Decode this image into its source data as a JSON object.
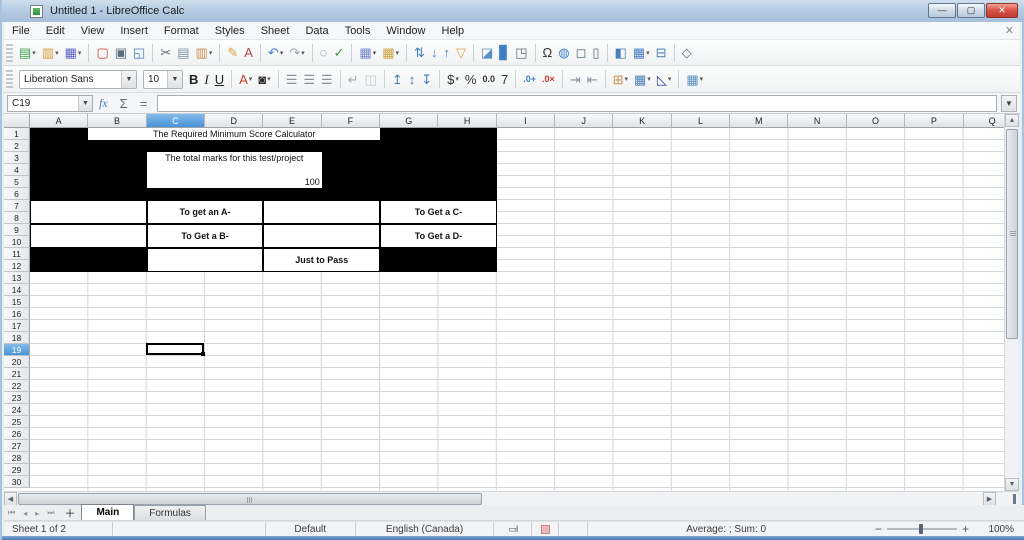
{
  "window": {
    "title": "Untitled 1 - LibreOffice Calc",
    "controls": {
      "minimize": "—",
      "maximize": "▢",
      "close": "✕"
    }
  },
  "menu": {
    "items": [
      "File",
      "Edit",
      "View",
      "Insert",
      "Format",
      "Styles",
      "Sheet",
      "Data",
      "Tools",
      "Window",
      "Help"
    ],
    "close_document": "✕"
  },
  "toolbar_main": {
    "items": [
      {
        "name": "new",
        "glyph": "▤",
        "color": "#3f9e4d",
        "dropdown": true
      },
      {
        "name": "open",
        "glyph": "▥",
        "color": "#dc9a3a",
        "dropdown": true
      },
      {
        "name": "save",
        "glyph": "▦",
        "color": "#5b63c6",
        "dropdown": true
      },
      {
        "name": "sep"
      },
      {
        "name": "export-pdf",
        "glyph": "▢",
        "color": "#cf4436"
      },
      {
        "name": "print",
        "glyph": "▣",
        "color": "#5a6b7c"
      },
      {
        "name": "print-preview",
        "glyph": "◱",
        "color": "#4a7ebb"
      },
      {
        "name": "sep"
      },
      {
        "name": "cut",
        "glyph": "✂",
        "color": "#5a6b7c"
      },
      {
        "name": "copy",
        "glyph": "▤",
        "color": "#7d93a8"
      },
      {
        "name": "paste",
        "glyph": "▥",
        "color": "#c98f4e",
        "dropdown": true
      },
      {
        "name": "sep"
      },
      {
        "name": "clone-formatting",
        "glyph": "✎",
        "color": "#d9a23c"
      },
      {
        "name": "clear-formatting",
        "glyph": "A",
        "color": "#b04a52"
      },
      {
        "name": "sep"
      },
      {
        "name": "undo",
        "glyph": "↶",
        "color": "#3f7fc4",
        "dropdown": true
      },
      {
        "name": "redo",
        "glyph": "↷",
        "color": "#9aa6b2",
        "dropdown": true
      },
      {
        "name": "sep"
      },
      {
        "name": "find-and-replace",
        "glyph": "◌",
        "color": "#4a7ebb"
      },
      {
        "name": "spelling",
        "glyph": "✓",
        "color": "#3f9e4d"
      },
      {
        "name": "sep"
      },
      {
        "name": "insert-row",
        "glyph": "▦",
        "color": "#6f87c9",
        "dropdown": true
      },
      {
        "name": "insert-column",
        "glyph": "▦",
        "color": "#c9a23c",
        "dropdown": true
      },
      {
        "name": "sep"
      },
      {
        "name": "sort",
        "glyph": "⇅",
        "color": "#3f7fc4"
      },
      {
        "name": "sort-ascending",
        "glyph": "↓",
        "color": "#3f7fc4"
      },
      {
        "name": "sort-descending",
        "glyph": "↑",
        "color": "#3f7fc4"
      },
      {
        "name": "autofilter",
        "glyph": "▽",
        "color": "#d9a23c"
      },
      {
        "name": "sep"
      },
      {
        "name": "insert-image",
        "glyph": "◪",
        "color": "#5a8fc4"
      },
      {
        "name": "insert-chart",
        "glyph": "▊",
        "color": "#3f7fc4"
      },
      {
        "name": "insert-pivot-table",
        "glyph": "◳",
        "color": "#5a6b7c"
      },
      {
        "name": "sep"
      },
      {
        "name": "special-character",
        "glyph": "Ω",
        "color": "#333333"
      },
      {
        "name": "insert-hyperlink",
        "glyph": "◍",
        "color": "#3f7fc4"
      },
      {
        "name": "insert-comment",
        "glyph": "◻",
        "color": "#5a6b7c"
      },
      {
        "name": "headers-and-footers",
        "glyph": "▯",
        "color": "#5a6b7c"
      },
      {
        "name": "sep"
      },
      {
        "name": "insert-page-break",
        "glyph": "◧",
        "color": "#4a7ebb"
      },
      {
        "name": "freeze-rows-and-columns",
        "glyph": "▦",
        "color": "#4a7ebb",
        "dropdown": true
      },
      {
        "name": "split-window",
        "glyph": "⊟",
        "color": "#4a7ebb"
      },
      {
        "name": "sep"
      },
      {
        "name": "show-draw-functions",
        "glyph": "◇",
        "color": "#5a6b7c"
      }
    ]
  },
  "toolbar_format": {
    "font_name": "Liberation Sans",
    "font_size": "10",
    "items": [
      {
        "name": "bold",
        "glyph": "B",
        "color": "#222",
        "cls": "bold-b"
      },
      {
        "name": "italic",
        "glyph": "I",
        "color": "#222",
        "cls": "ital-i"
      },
      {
        "name": "underline",
        "glyph": "U",
        "color": "#222",
        "cls": "und-u"
      },
      {
        "name": "sep"
      },
      {
        "name": "font-color",
        "glyph": "A",
        "color": "#c0392b",
        "dropdown": true
      },
      {
        "name": "highlighting-color",
        "glyph": "◙",
        "color": "#2b2b2b",
        "dropdown": true
      },
      {
        "name": "sep"
      },
      {
        "name": "align-left",
        "glyph": "☰",
        "color": "#8a949e"
      },
      {
        "name": "align-center",
        "glyph": "☰",
        "color": "#8a949e"
      },
      {
        "name": "align-right",
        "glyph": "☰",
        "color": "#8a949e"
      },
      {
        "name": "sep"
      },
      {
        "name": "wrap-text",
        "glyph": "↵",
        "color": "#9aa6b2"
      },
      {
        "name": "merge-cells",
        "glyph": "◫",
        "color": "#c4cad0"
      },
      {
        "name": "sep"
      },
      {
        "name": "align-top",
        "glyph": "↥",
        "color": "#4a7ebb"
      },
      {
        "name": "center-vertically",
        "glyph": "↕",
        "color": "#4a7ebb"
      },
      {
        "name": "align-bottom",
        "glyph": "↧",
        "color": "#4a7ebb"
      },
      {
        "name": "sep"
      },
      {
        "name": "format-as-currency",
        "glyph": "$",
        "color": "#333",
        "dropdown": true
      },
      {
        "name": "format-as-percent",
        "glyph": "%",
        "color": "#333"
      },
      {
        "name": "format-as-number",
        "glyph": "0.0",
        "color": "#333"
      },
      {
        "name": "format-as-date",
        "glyph": "7",
        "color": "#333"
      },
      {
        "name": "sep"
      },
      {
        "name": "add-decimal-place",
        "glyph": ".0+",
        "color": "#3f7fc4"
      },
      {
        "name": "delete-decimal-place",
        "glyph": ".0×",
        "color": "#c0392b"
      },
      {
        "name": "sep"
      },
      {
        "name": "increase-indent",
        "glyph": "⇥",
        "color": "#8a949e"
      },
      {
        "name": "decrease-indent",
        "glyph": "⇤",
        "color": "#8a949e"
      },
      {
        "name": "sep"
      },
      {
        "name": "borders",
        "glyph": "⊞",
        "color": "#c98f4e",
        "dropdown": true
      },
      {
        "name": "border-style",
        "glyph": "▦",
        "color": "#4a7ebb",
        "dropdown": true
      },
      {
        "name": "border-color",
        "glyph": "◺",
        "color": "#2b3f8f",
        "dropdown": true
      },
      {
        "name": "sep"
      },
      {
        "name": "conditional-formatting",
        "glyph": "▦",
        "color": "#5a8fc4",
        "dropdown": true
      }
    ]
  },
  "formula_bar": {
    "cell_reference": "C19",
    "formula_value": "",
    "icons": {
      "function_wizard": "fx",
      "select_sum": "Σ",
      "formula": "="
    }
  },
  "grid": {
    "columns": [
      "A",
      "B",
      "C",
      "D",
      "E",
      "F",
      "G",
      "H",
      "I",
      "J",
      "K",
      "L",
      "M",
      "N",
      "O",
      "P",
      "Q"
    ],
    "row_count": 30,
    "selected_column": "C",
    "selected_row": 19,
    "cursor_cell": "C19",
    "cells": [
      {
        "name": "black-block-top",
        "col": 0,
        "colspan": 8,
        "row": 1,
        "rowspan": 6,
        "type": "black",
        "text": ""
      },
      {
        "name": "title-cell",
        "col": 1,
        "colspan": 5,
        "row": 1,
        "rowspan": 1,
        "type": "plain",
        "text": "The Required Minimum Score Calculator"
      },
      {
        "name": "total-marks-label-cell",
        "col": 2,
        "colspan": 3,
        "row": 3,
        "rowspan": 1,
        "type": "plain",
        "text": "The total marks for this test/project"
      },
      {
        "name": "total-marks-value-cell",
        "col": 2,
        "colspan": 3,
        "row": 4,
        "rowspan": 2,
        "type": "plain",
        "text": "100",
        "align": "br"
      },
      {
        "name": "score-a-input-cell",
        "col": 0,
        "colspan": 2,
        "row": 7,
        "rowspan": 2,
        "type": "boxed",
        "text": ""
      },
      {
        "name": "grade-a-label-cell",
        "col": 2,
        "colspan": 2,
        "row": 7,
        "rowspan": 2,
        "type": "boxed",
        "text": "To get an A-"
      },
      {
        "name": "score-c-input-cell",
        "col": 4,
        "colspan": 2,
        "row": 7,
        "rowspan": 2,
        "type": "boxed",
        "text": ""
      },
      {
        "name": "grade-c-label-cell",
        "col": 6,
        "colspan": 2,
        "row": 7,
        "rowspan": 2,
        "type": "boxed",
        "text": "To Get a C-"
      },
      {
        "name": "score-b-input-cell",
        "col": 0,
        "colspan": 2,
        "row": 9,
        "rowspan": 2,
        "type": "boxed",
        "text": ""
      },
      {
        "name": "grade-b-label-cell",
        "col": 2,
        "colspan": 2,
        "row": 9,
        "rowspan": 2,
        "type": "boxed",
        "text": "To Get a B-"
      },
      {
        "name": "score-d-input-cell",
        "col": 4,
        "colspan": 2,
        "row": 9,
        "rowspan": 2,
        "type": "boxed",
        "text": ""
      },
      {
        "name": "grade-d-label-cell",
        "col": 6,
        "colspan": 2,
        "row": 9,
        "rowspan": 2,
        "type": "boxed",
        "text": "To Get a D-"
      },
      {
        "name": "black-block-bottom-left",
        "col": 0,
        "colspan": 2,
        "row": 11,
        "rowspan": 2,
        "type": "black",
        "text": ""
      },
      {
        "name": "pass-input-cell",
        "col": 2,
        "colspan": 2,
        "row": 11,
        "rowspan": 2,
        "type": "boxed",
        "text": ""
      },
      {
        "name": "pass-label-cell",
        "col": 4,
        "colspan": 2,
        "row": 11,
        "rowspan": 2,
        "type": "boxed",
        "text": "Just to Pass"
      },
      {
        "name": "black-block-bottom-right",
        "col": 6,
        "colspan": 2,
        "row": 11,
        "rowspan": 2,
        "type": "black",
        "text": ""
      }
    ]
  },
  "sheet_tabs": {
    "nav": [
      "⏮",
      "◂",
      "▸",
      "⏭"
    ],
    "add_label": "＋",
    "tabs": [
      {
        "label": "Main",
        "active": true
      },
      {
        "label": "Formulas",
        "active": false
      }
    ]
  },
  "status_bar": {
    "sheet_info": "Sheet 1 of 2",
    "page_style": "Default",
    "language": "English (Canada)",
    "selection_stats": "Average: ; Sum: 0",
    "zoom_level": "100%"
  }
}
